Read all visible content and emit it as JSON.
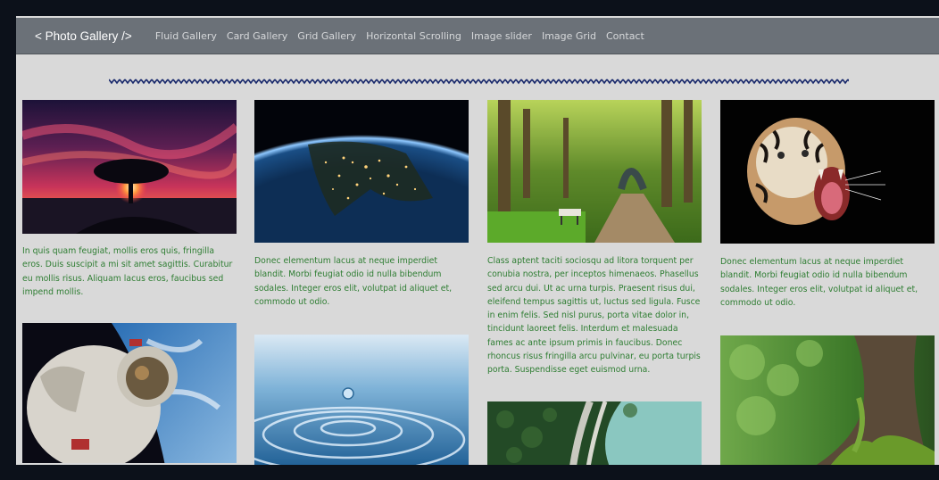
{
  "navbar": {
    "brand": "< Photo Gallery />",
    "links": [
      "Fluid Gallery",
      "Card Gallery",
      "Grid Gallery",
      "Horizontal Scrolling",
      "Image slider",
      "Image Grid",
      "Contact"
    ]
  },
  "gallery": {
    "captions": [
      "In quis quam feugiat, mollis eros quis, fringilla eros. Duis suscipit a mi sit amet sagittis. Curabitur eu mollis risus. Aliquam lacus eros, faucibus sed impend mollis.",
      "Donec elementum lacus at neque imperdiet blandit. Morbi feugiat odio id nulla bibendum sodales. Integer eros elit, volutpat id aliquet et, commodo ut odio.",
      "Class aptent taciti sociosqu ad litora torquent per conubia nostra, per inceptos himenaeos. Phasellus sed arcu dui. Ut ac urna turpis. Praesent risus dui, eleifend tempus sagittis ut, luctus sed ligula. Fusce in enim felis. Sed nisl purus, porta vitae dolor in, tincidunt laoreet felis. Interdum et malesuada fames ac ante ipsum primis in faucibus. Donec rhoncus risus fringilla arcu pulvinar, eu porta turpis porta. Suspendisse eget euismod urna.",
      "Donec elementum lacus at neque imperdiet blandit. Morbi feugiat odio id nulla bibendum sodales. Integer eros elit, volutpat id aliquet et, commodo ut odio."
    ]
  },
  "colors": {
    "navbar_bg": "#6b7178",
    "page_bg": "#d9d9d9",
    "caption_text": "#2e7d32",
    "zigzag": "#1a2a6c"
  }
}
